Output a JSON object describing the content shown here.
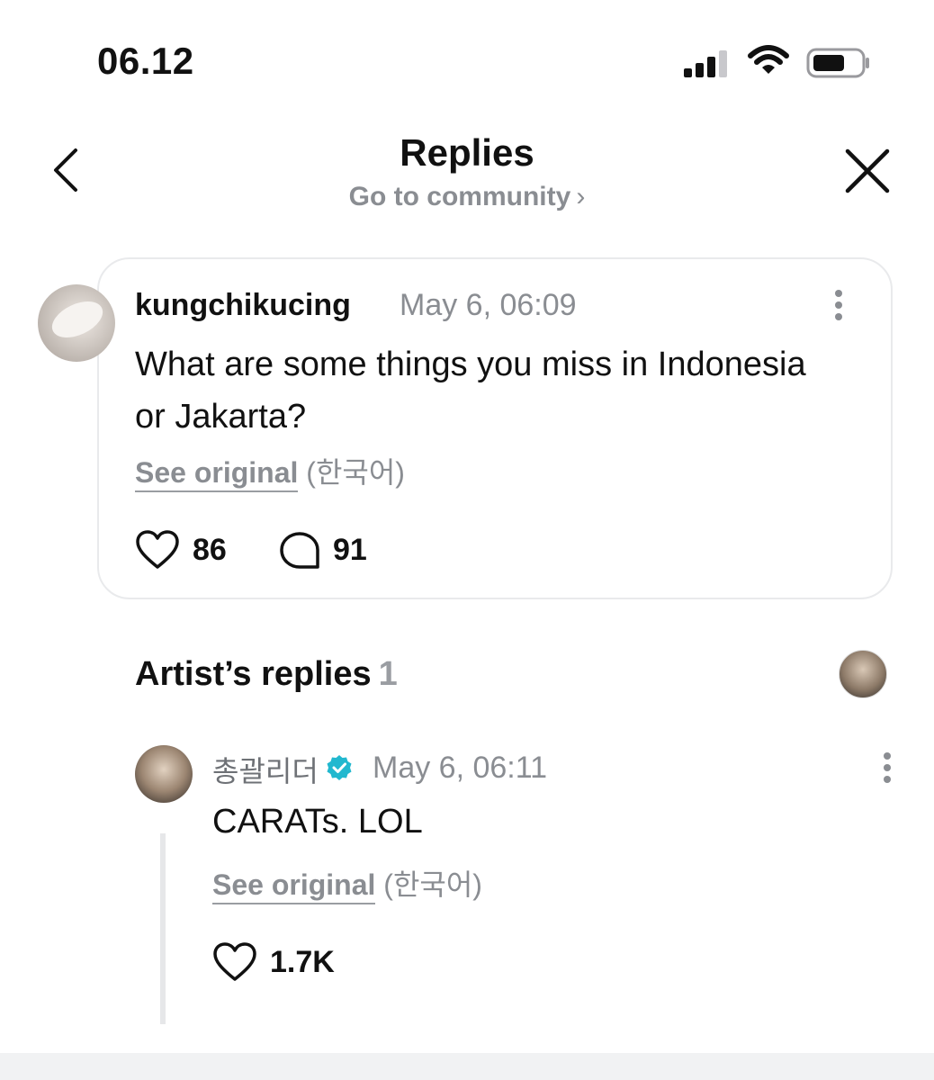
{
  "status_bar": {
    "time": "06.12"
  },
  "header": {
    "title": "Replies",
    "subtitle": "Go to community",
    "subtitle_chevron": "›"
  },
  "post": {
    "username": "kungchikucing",
    "date": "May 6, 06:09",
    "body": "What are some things you miss in Indonesia or Jakarta?",
    "see_original": "See original",
    "language": "(한국어)",
    "likes": "86",
    "comments": "91"
  },
  "artist_replies": {
    "title": "Artist’s replies",
    "count": "1",
    "reply": {
      "name": "총괄리더",
      "date": "May 6, 06:11",
      "body": "CARATs. LOL",
      "see_original": "See original",
      "language": "(한국어)",
      "likes": "1.7K"
    }
  },
  "colors": {
    "verified_badge": "#22b8cf",
    "muted_text": "#8a8d92",
    "card_border": "#e9eaec"
  },
  "icons": [
    "signal-icon",
    "wifi-icon",
    "battery-icon",
    "back-icon",
    "close-icon",
    "more-icon",
    "heart-icon",
    "comment-icon",
    "verified-badge-icon"
  ]
}
